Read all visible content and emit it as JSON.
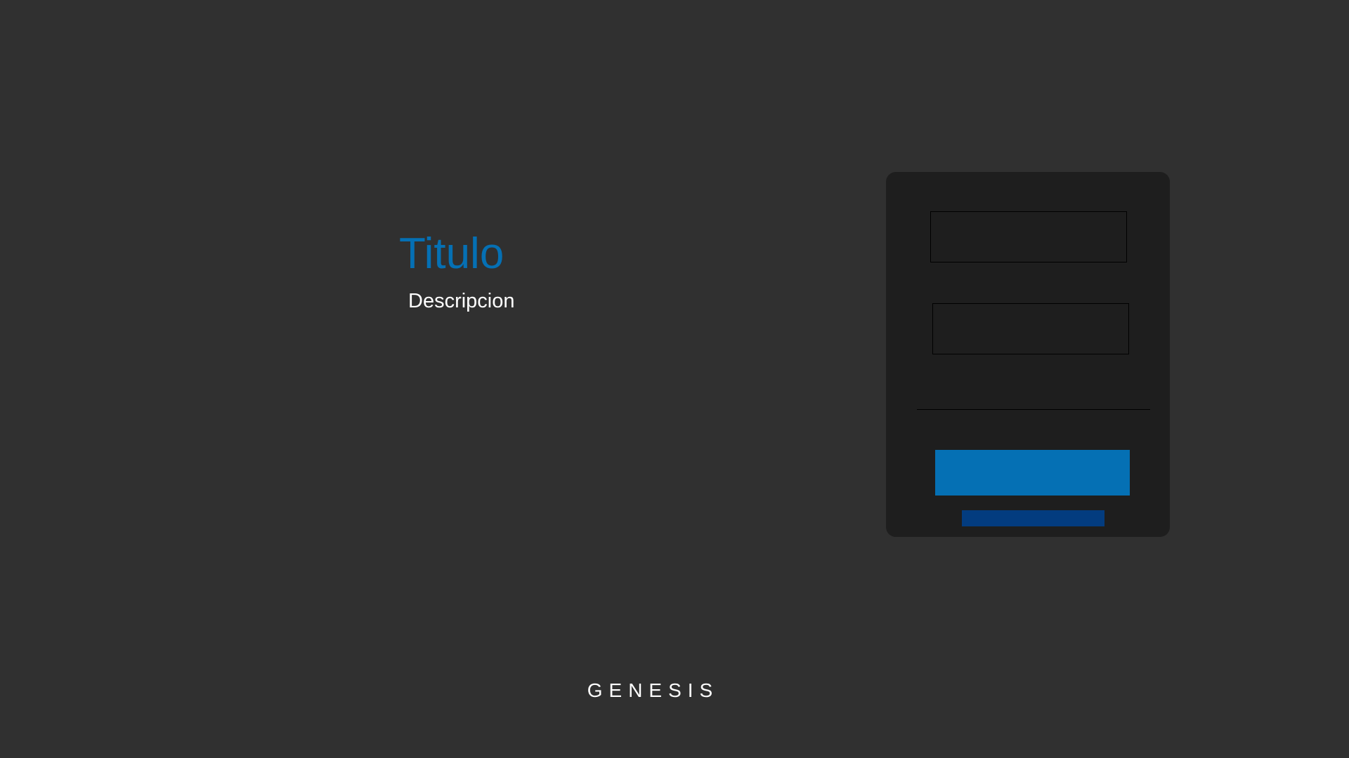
{
  "hero": {
    "title": "Titulo",
    "description": "Descripcion"
  },
  "login_form": {
    "username": {
      "value": "",
      "placeholder": ""
    },
    "password": {
      "value": "",
      "placeholder": ""
    },
    "submit_label": "",
    "secondary_label": ""
  },
  "footer": {
    "brand": "GENESIS"
  },
  "colors": {
    "background": "#303030",
    "card": "#1E1E1E",
    "accent": "#0570B4",
    "secondary_accent": "#033C7F",
    "text": "#FFFFFF"
  }
}
